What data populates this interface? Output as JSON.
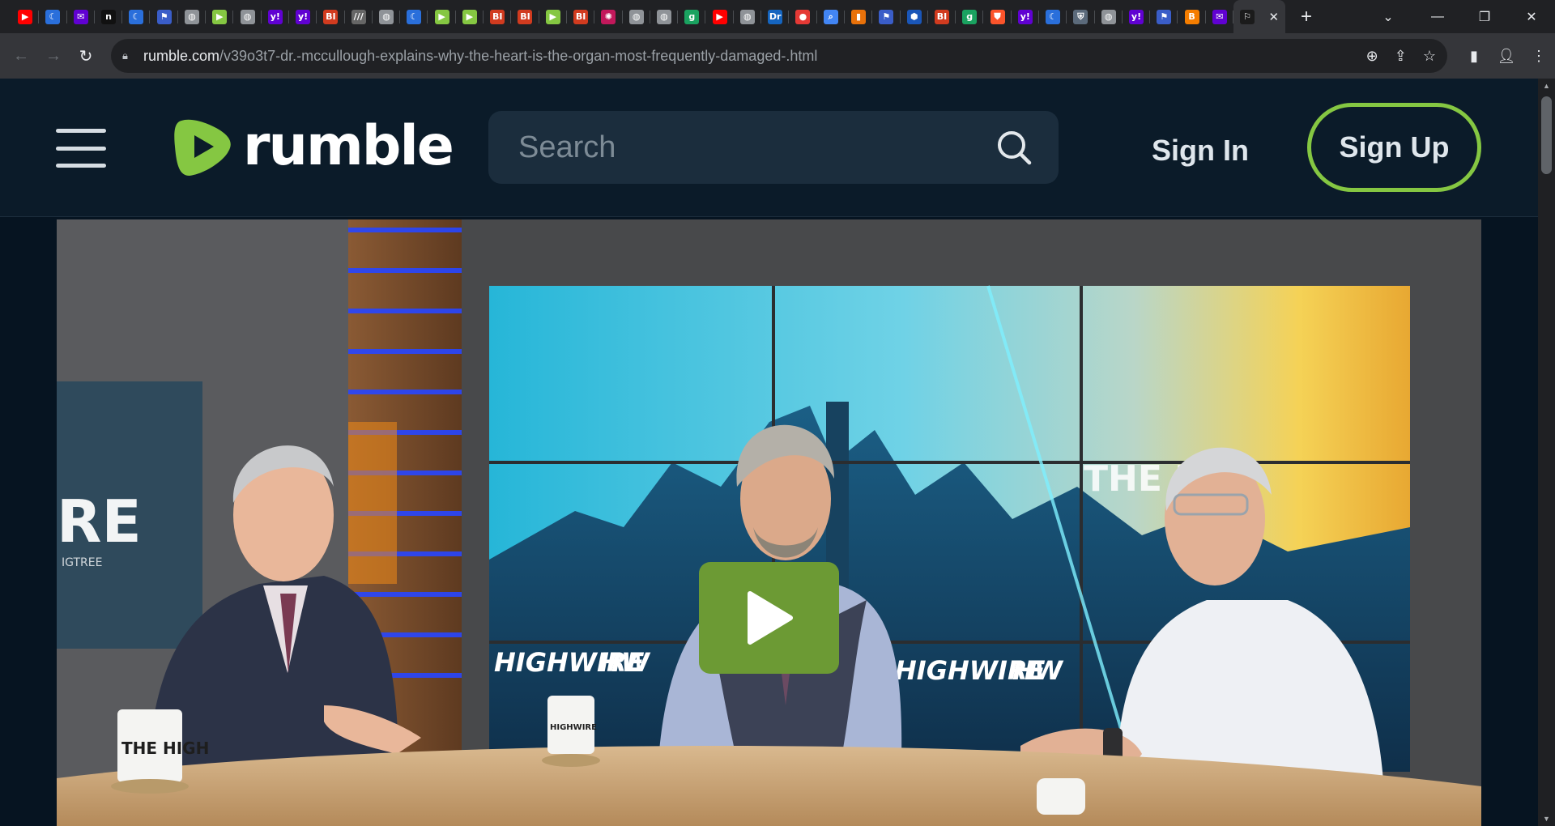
{
  "browser": {
    "tabs": [
      {
        "icon": "youtube-icon",
        "glyph": "▶",
        "color": "#ff0000"
      },
      {
        "icon": "crescent-icon",
        "glyph": "☾",
        "color": "#2a6fdb"
      },
      {
        "icon": "yahoo-mail-icon",
        "glyph": "✉",
        "color": "#6001d2"
      },
      {
        "icon": "notion-icon",
        "glyph": "n",
        "color": "#111111"
      },
      {
        "icon": "crescent-icon",
        "glyph": "☾",
        "color": "#2a6fdb"
      },
      {
        "icon": "flag-icon",
        "glyph": "⚑",
        "color": "#3a5dc8"
      },
      {
        "icon": "globe-icon",
        "glyph": "◍",
        "color": "#8f9398"
      },
      {
        "icon": "rumble-icon",
        "glyph": "▶",
        "color": "#85c742"
      },
      {
        "icon": "globe-icon",
        "glyph": "◍",
        "color": "#8f9398"
      },
      {
        "icon": "yahoo-icon",
        "glyph": "y!",
        "color": "#6001d2"
      },
      {
        "icon": "yahoo-icon",
        "glyph": "y!",
        "color": "#6001d2"
      },
      {
        "icon": "business-insider-icon",
        "glyph": "BI",
        "color": "#d13b1f"
      },
      {
        "icon": "slashes-icon",
        "glyph": "///",
        "color": "#666666"
      },
      {
        "icon": "globe-icon",
        "glyph": "◍",
        "color": "#8f9398"
      },
      {
        "icon": "crescent-icon",
        "glyph": "☾",
        "color": "#2a6fdb"
      },
      {
        "icon": "rumble-icon",
        "glyph": "▶",
        "color": "#85c742"
      },
      {
        "icon": "rumble-icon",
        "glyph": "▶",
        "color": "#85c742"
      },
      {
        "icon": "business-insider-icon",
        "glyph": "BI",
        "color": "#d13b1f"
      },
      {
        "icon": "business-insider-icon",
        "glyph": "BI",
        "color": "#d13b1f"
      },
      {
        "icon": "rumble-icon",
        "glyph": "▶",
        "color": "#85c742"
      },
      {
        "icon": "business-insider-icon",
        "glyph": "BI",
        "color": "#d13b1f"
      },
      {
        "icon": "starburst-icon",
        "glyph": "✺",
        "color": "#c2185b"
      },
      {
        "icon": "globe-icon",
        "glyph": "◍",
        "color": "#8f9398"
      },
      {
        "icon": "globe-icon",
        "glyph": "◍",
        "color": "#8f9398"
      },
      {
        "icon": "g-icon",
        "glyph": "g",
        "color": "#1aa260"
      },
      {
        "icon": "youtube-icon",
        "glyph": "▶",
        "color": "#ff0000"
      },
      {
        "icon": "globe-icon",
        "glyph": "◍",
        "color": "#8f9398"
      },
      {
        "icon": "dr-icon",
        "glyph": "Dr",
        "color": "#1565c0"
      },
      {
        "icon": "podcast-icon",
        "glyph": "●",
        "color": "#e53935"
      },
      {
        "icon": "search-icon",
        "glyph": "⌕",
        "color": "#4285f4"
      },
      {
        "icon": "bookmark-icon",
        "glyph": "▮",
        "color": "#e8710a"
      },
      {
        "icon": "flag-icon",
        "glyph": "⚑",
        "color": "#3a5dc8"
      },
      {
        "icon": "hexagon-icon",
        "glyph": "⬢",
        "color": "#1a56b8"
      },
      {
        "icon": "business-insider-icon",
        "glyph": "BI",
        "color": "#d13b1f"
      },
      {
        "icon": "g-icon",
        "glyph": "g",
        "color": "#1aa260"
      },
      {
        "icon": "brave-icon",
        "glyph": "⛊",
        "color": "#fb542b"
      },
      {
        "icon": "yahoo-icon",
        "glyph": "y!",
        "color": "#6001d2"
      },
      {
        "icon": "crescent-icon",
        "glyph": "☾",
        "color": "#2a6fdb"
      },
      {
        "icon": "crest-icon",
        "glyph": "⛨",
        "color": "#5b6a7b"
      },
      {
        "icon": "globe-icon",
        "glyph": "◍",
        "color": "#8f9398"
      },
      {
        "icon": "yahoo-icon",
        "glyph": "y!",
        "color": "#6001d2"
      },
      {
        "icon": "flag-icon",
        "glyph": "⚑",
        "color": "#3a5dc8"
      },
      {
        "icon": "blogger-icon",
        "glyph": "B",
        "color": "#f57d00"
      },
      {
        "icon": "yahoo-mail-icon",
        "glyph": "✉",
        "color": "#6001d2"
      }
    ],
    "active_tab": {
      "icon": "exit-icon",
      "glyph": "⚐",
      "color": "#ffffff"
    },
    "url_host": "rumble.com",
    "url_path": "/v39o3t7-dr.-mccullough-explains-why-the-heart-is-the-organ-most-frequently-damaged-.html"
  },
  "site": {
    "logo_text": "rumble",
    "search_placeholder": "Search",
    "signin_label": "Sign In",
    "signup_label": "Sign Up"
  },
  "video": {
    "wall_text_center": "THE HIG",
    "set_text_left": "HIGHWIRE",
    "set_text_right": "HIGHWIRE",
    "hw_logo": "HW",
    "mug_left_text": "THE HIGH",
    "mug_center_text": "HIGHWIRE",
    "left_screen_text": "RE",
    "left_screen_subtext": "IGTREE"
  },
  "colors": {
    "rumble_green": "#85c742",
    "page_bg": "#061421",
    "header_bg": "#0b1b29",
    "play_button": "#6c9a34"
  }
}
